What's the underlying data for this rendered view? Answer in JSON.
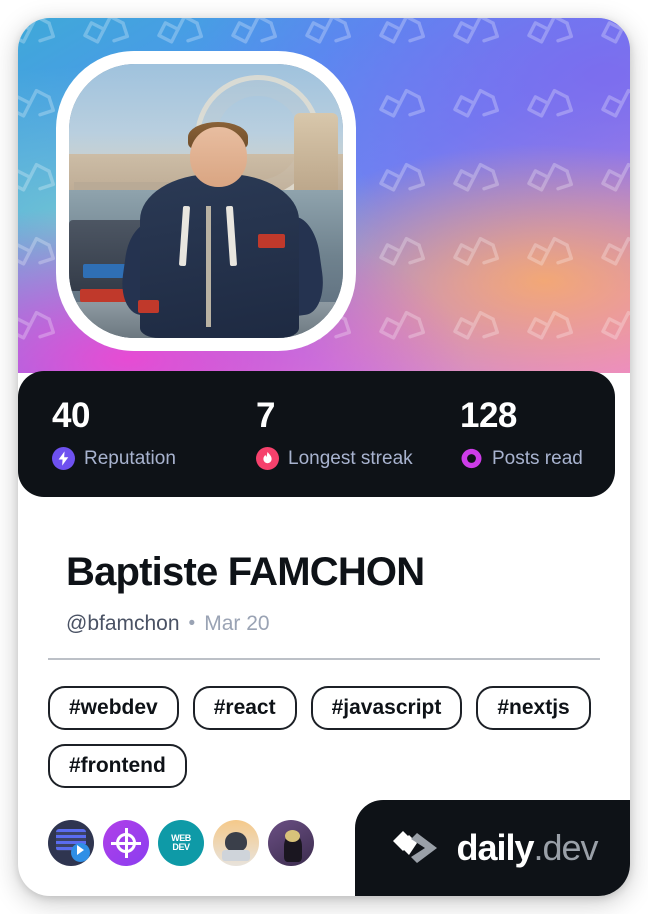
{
  "card": {
    "cover": {
      "pattern_icon": "daily-dev-logo-watermark",
      "gradient_colors": [
        "#3fa9d8",
        "#4f93f0",
        "#6d86f2",
        "#b887e0",
        "#e985d8"
      ]
    },
    "avatar": {
      "alt": "Profile photo of Baptiste FAMCHON in London by the Thames"
    },
    "stats": [
      {
        "value": "40",
        "label": "Reputation",
        "icon": "reputation-bolt-icon",
        "color": "#6e51f0"
      },
      {
        "value": "7",
        "label": "Longest streak",
        "icon": "streak-flame-icon",
        "color": "#f6416c"
      },
      {
        "value": "128",
        "label": "Posts read",
        "icon": "posts-read-eye-icon",
        "color": "#cd3ce8"
      }
    ],
    "identity": {
      "name": "Baptiste FAMCHON",
      "handle": "@bfamchon",
      "separator": "•",
      "date": "Mar 20"
    },
    "tags": [
      "#webdev",
      "#react",
      "#javascript",
      "#nextjs",
      "#frontend"
    ],
    "sources": [
      {
        "name": "source-avatar-1"
      },
      {
        "name": "source-avatar-2"
      },
      {
        "name": "source-avatar-3",
        "line1": "WEB",
        "line2": "DEV"
      },
      {
        "name": "source-avatar-4"
      },
      {
        "name": "source-avatar-5"
      }
    ],
    "logo": {
      "brand": "daily",
      "suffix": ".dev",
      "mark": "daily-dev-chevron-mark"
    }
  }
}
